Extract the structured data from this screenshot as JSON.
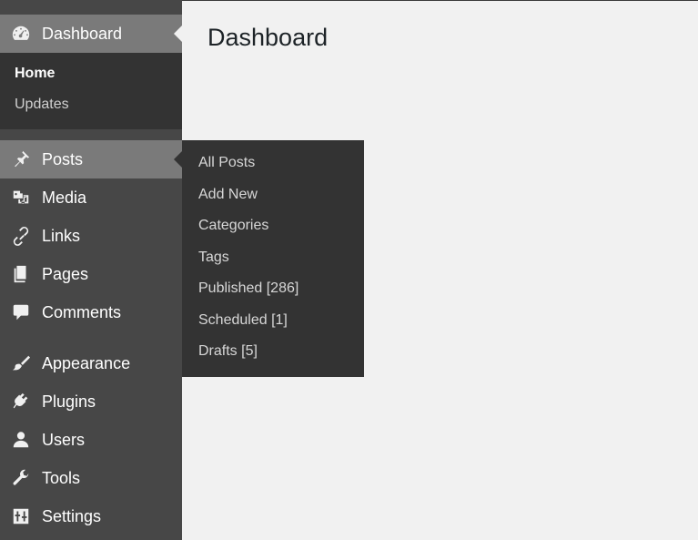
{
  "page": {
    "title": "Dashboard"
  },
  "sidebar": {
    "dashboard": {
      "label": "Dashboard",
      "icon": "dashboard-gauge-icon",
      "submenu": [
        {
          "label": "Home",
          "current": true
        },
        {
          "label": "Updates",
          "current": false
        }
      ]
    },
    "items": [
      {
        "label": "Posts",
        "icon": "pushpin-icon"
      },
      {
        "label": "Media",
        "icon": "media-icon"
      },
      {
        "label": "Links",
        "icon": "link-icon"
      },
      {
        "label": "Pages",
        "icon": "pages-icon"
      },
      {
        "label": "Comments",
        "icon": "comment-icon"
      },
      {
        "label": "Appearance",
        "icon": "paintbrush-icon"
      },
      {
        "label": "Plugins",
        "icon": "plugin-icon"
      },
      {
        "label": "Users",
        "icon": "user-icon"
      },
      {
        "label": "Tools",
        "icon": "wrench-icon"
      },
      {
        "label": "Settings",
        "icon": "settings-sliders-icon"
      }
    ]
  },
  "flyout": {
    "parent": "Posts",
    "items": [
      {
        "label": "All Posts"
      },
      {
        "label": "Add New"
      },
      {
        "label": "Categories"
      },
      {
        "label": "Tags"
      },
      {
        "label": "Published [286]"
      },
      {
        "label": "Scheduled [1]"
      },
      {
        "label": "Drafts [5]"
      }
    ]
  },
  "colors": {
    "sidebar_bg": "#474747",
    "submenu_bg": "#333333",
    "highlight_bg": "#7a7a7a",
    "content_bg": "#f1f1f1"
  }
}
